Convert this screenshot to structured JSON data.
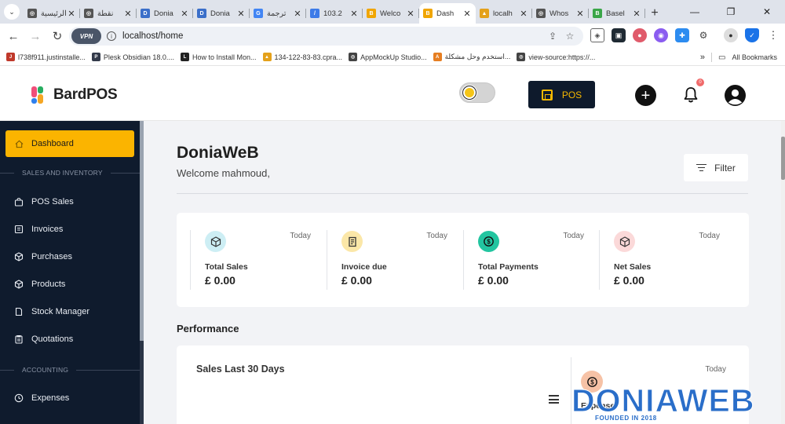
{
  "browser": {
    "tabs": [
      {
        "title": "الرئيسية",
        "fav_color": "#555555",
        "fav_glyph": "◎"
      },
      {
        "title": "نقطة",
        "fav_color": "#555555",
        "fav_glyph": "◎"
      },
      {
        "title": "Donia",
        "fav_color": "#3b6fc9",
        "fav_glyph": "D"
      },
      {
        "title": "Donia",
        "fav_color": "#3b6fc9",
        "fav_glyph": "D"
      },
      {
        "title": "ترجمة",
        "fav_color": "#4285f4",
        "fav_glyph": "G"
      },
      {
        "title": "103.2",
        "fav_color": "#3d7be8",
        "fav_glyph": "/"
      },
      {
        "title": "Welco",
        "fav_color": "#f0a500",
        "fav_glyph": "B"
      },
      {
        "title": "Dash",
        "fav_color": "#f0a500",
        "fav_glyph": "B"
      },
      {
        "title": "localh",
        "fav_color": "#e4a11b",
        "fav_glyph": "▲"
      },
      {
        "title": "Whos",
        "fav_color": "#555555",
        "fav_glyph": "◎"
      },
      {
        "title": "Basel",
        "fav_color": "#3aa648",
        "fav_glyph": "B"
      }
    ],
    "active_tab_index": 7,
    "url": "localhost/home",
    "vpn_label": "VPN",
    "bookmarks": [
      {
        "label": "l738f911.justinstalle...",
        "color": "#c0392b",
        "glyph": "J"
      },
      {
        "label": "Plesk Obsidian 18.0....",
        "color": "#333a4a",
        "glyph": "P"
      },
      {
        "label": "How to Install Mon...",
        "color": "#222222",
        "glyph": "L"
      },
      {
        "label": "134-122-83-83.cpra...",
        "color": "#e4a11b",
        "glyph": "▲"
      },
      {
        "label": "AppMockUp Studio...",
        "color": "#444444",
        "glyph": "◎"
      },
      {
        "label": "استخدم وحل مشكلة...",
        "color": "#e67e22",
        "glyph": "A"
      },
      {
        "label": "view-source:https://...",
        "color": "#444444",
        "glyph": "◎"
      }
    ],
    "all_bookmarks_label": "All Bookmarks"
  },
  "header": {
    "brand": "BardPOS",
    "pos_label": "POS",
    "notification_count": "0"
  },
  "sidebar": {
    "active": "Dashboard",
    "sections": [
      "SALES AND INVENTORY",
      "ACCOUNTING"
    ],
    "items": [
      "POS Sales",
      "Invoices",
      "Purchases",
      "Products",
      "Stock Manager",
      "Quotations",
      "Expenses"
    ]
  },
  "main": {
    "title": "DoniaWeB",
    "welcome": "Welcome mahmoud,",
    "filter_label": "Filter",
    "stats": [
      {
        "label": "Total Sales",
        "value": "£ 0.00",
        "period": "Today",
        "bg": "#cdeef4",
        "icon": "box-icon"
      },
      {
        "label": "Invoice due",
        "value": "£ 0.00",
        "period": "Today",
        "bg": "#fbe7a8",
        "icon": "document-icon"
      },
      {
        "label": "Total Payments",
        "value": "£ 0.00",
        "period": "Today",
        "bg": "#22c5a0",
        "icon": "dollar-cycle-icon"
      },
      {
        "label": "Net Sales",
        "value": "£ 0.00",
        "period": "Today",
        "bg": "#fbd9d9",
        "icon": "box-check-icon"
      }
    ],
    "performance_title": "Performance",
    "sales_chart_title": "Sales Last 30 Days",
    "expense_period": "Today",
    "expense_label": "Expense"
  },
  "watermark": {
    "text": "DONIAWEB",
    "sub": "FOUNDED IN 2018"
  },
  "colors": {
    "accent": "#fbb400",
    "sidebar_bg": "#0f1b2d",
    "pos_button_bg": "#0e1a2c"
  }
}
